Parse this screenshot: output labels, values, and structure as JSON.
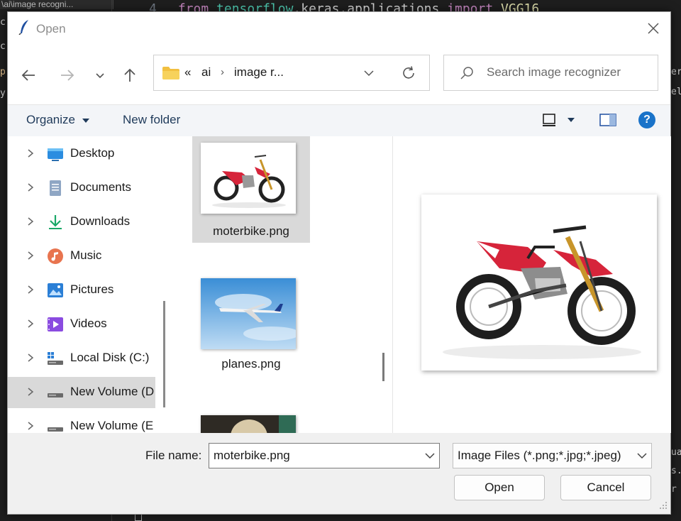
{
  "background": {
    "tab_label": "\\ai\\image recogni...",
    "line_number": "4",
    "code_from": "from",
    "code_module": "tensorflow",
    "code_mid": ".keras.applications",
    "code_import": "import",
    "code_class": "VGG16",
    "left_chars": [
      "c",
      "c",
      "p",
      "y"
    ],
    "right_chars": [
      "er",
      "el",
      "ua",
      "s.",
      "r"
    ]
  },
  "dialog": {
    "title": "Open",
    "address": {
      "overflow": "«",
      "crumbs": [
        "ai",
        "image r..."
      ]
    },
    "search_placeholder": "Search image recognizer",
    "toolbar": {
      "organize": "Organize",
      "new_folder": "New folder"
    },
    "nav_items": [
      {
        "label": "Desktop",
        "icon": "desktop-icon"
      },
      {
        "label": "Documents",
        "icon": "documents-icon"
      },
      {
        "label": "Downloads",
        "icon": "downloads-icon"
      },
      {
        "label": "Music",
        "icon": "music-icon"
      },
      {
        "label": "Pictures",
        "icon": "pictures-icon"
      },
      {
        "label": "Videos",
        "icon": "videos-icon"
      },
      {
        "label": "Local Disk (C:)",
        "icon": "local-disk-icon"
      },
      {
        "label": "New Volume (D",
        "icon": "drive-icon"
      },
      {
        "label": "New Volume (E",
        "icon": "drive-icon"
      }
    ],
    "files": [
      {
        "name": "moterbike.png"
      },
      {
        "name": "planes.png"
      },
      {
        "name": ""
      }
    ],
    "file_name_label": "File name:",
    "file_name_value": "moterbike.png",
    "file_type_value": "Image Files (*.png;*.jpg;*.jpeg)",
    "open_label": "Open",
    "cancel_label": "Cancel",
    "colors": {
      "accent": "#1a73c9",
      "selection": "#d9d9d9"
    }
  }
}
